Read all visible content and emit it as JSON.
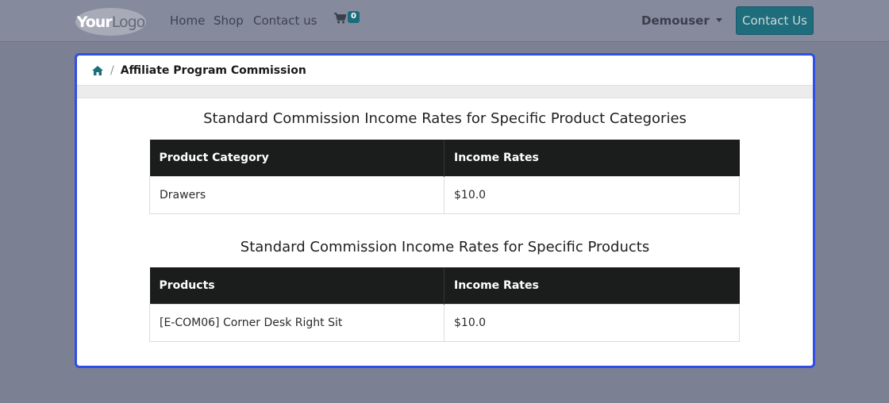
{
  "navbar": {
    "logo": {
      "bold": "Your",
      "thin": "Logo"
    },
    "links": [
      "Home",
      "Shop",
      "Contact us"
    ],
    "cart_count": "0",
    "user": "Demouser",
    "contact_button": "Contact Us"
  },
  "breadcrumb": {
    "current": "Affiliate Program Commission",
    "separator": "/"
  },
  "sections": [
    {
      "title": "Standard Commission Income Rates for Specific Product Categories",
      "headers": [
        "Product Category",
        "Income Rates"
      ],
      "rows": [
        [
          "Drawers",
          "$10.0"
        ]
      ]
    },
    {
      "title": "Standard Commission Income Rates for Specific Products",
      "headers": [
        "Products",
        "Income Rates"
      ],
      "rows": [
        [
          "[E-COM06] Corner Desk Right Sit",
          "$10.0"
        ]
      ]
    }
  ],
  "colors": {
    "accent": "#1d6d7c",
    "card_border": "#2f4fe6",
    "table_header": "#1b1d1d"
  }
}
